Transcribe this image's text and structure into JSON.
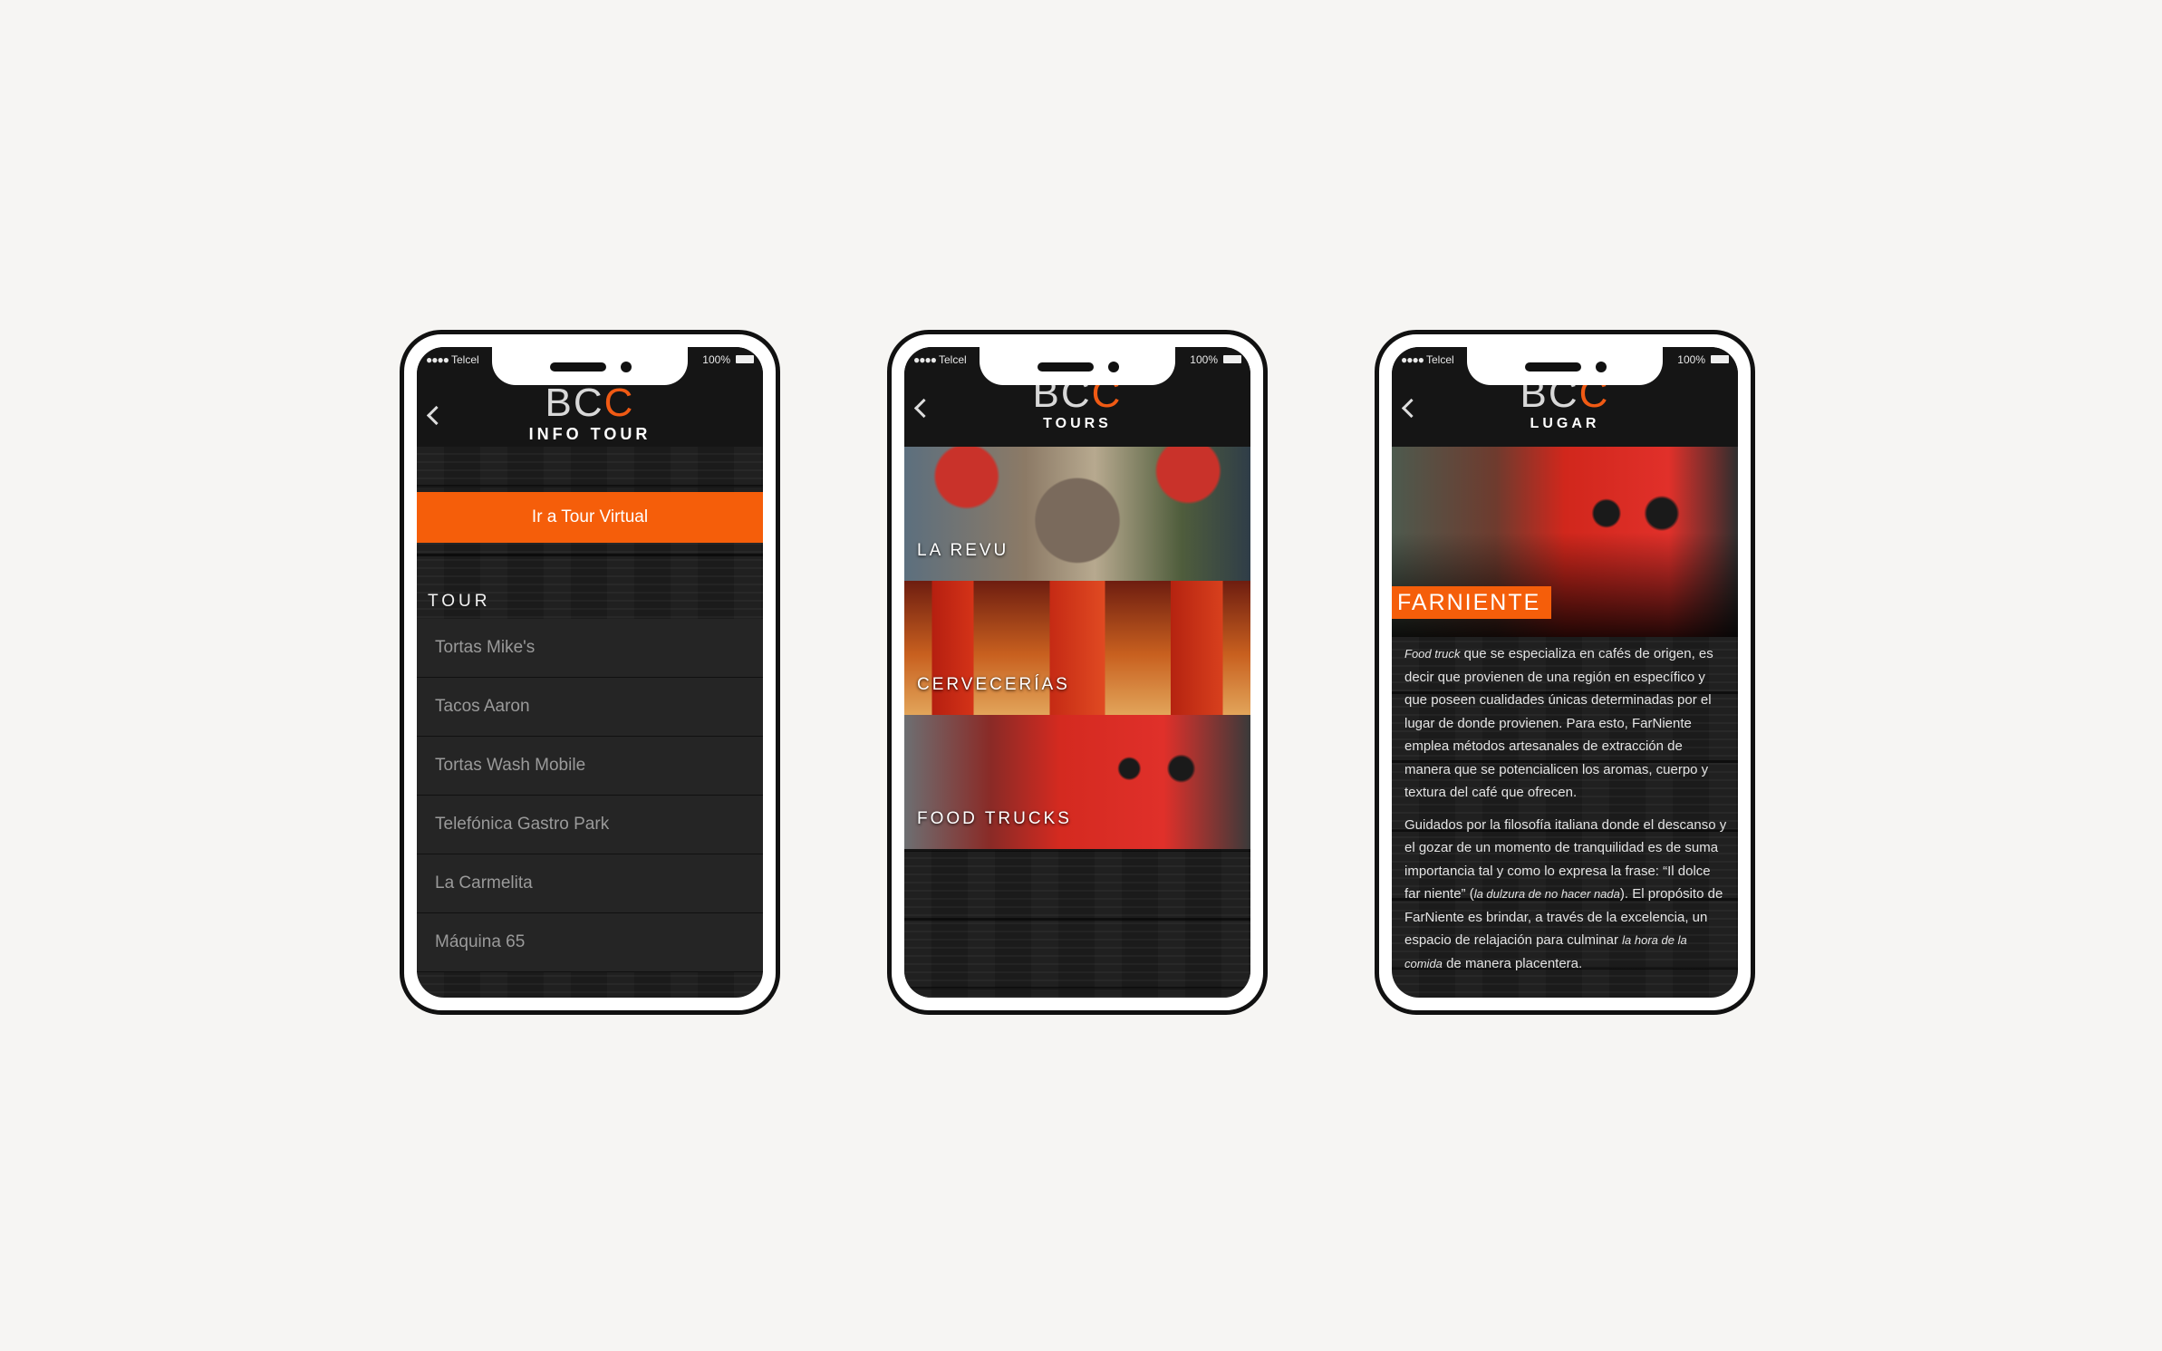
{
  "status_bar": {
    "signal": "●●●●",
    "carrier": "Telcel",
    "battery": "100%"
  },
  "app": {
    "logo_main": "BC",
    "logo_accent": "C",
    "accent_color": "#f55e0a"
  },
  "screen_info_tour": {
    "title": "INFO TOUR",
    "virtual_tour_button": "Ir a Tour Virtual",
    "section_label": "TOUR",
    "items": [
      "Tortas Mike's",
      "Tacos Aaron",
      "Tortas Wash Mobile",
      "Telefónica Gastro Park",
      "La Carmelita",
      "Máquina 65"
    ]
  },
  "screen_tours": {
    "title": "TOURS",
    "tiles": [
      "LA REVU",
      "CERVECERÍAS",
      "FOOD TRUCKS"
    ]
  },
  "screen_lugar": {
    "title": "LUGAR",
    "place_name": "FARNIENTE",
    "p1_em": "Food truck",
    "p1": " que se especializa en cafés de origen, es decir que provienen de una región en específico y que poseen cualidades únicas determinadas por el lugar de donde provienen. Para esto, FarNiente emplea métodos artesanales de extracción de manera que se potencialicen los aromas, cuerpo y textura del café que ofrecen.",
    "p2_a": "Guidados por la filosofía italiana donde el descanso y el gozar de un momento de tranquilidad es de suma importancia tal y como lo expresa la frase: “Il dolce far niente” (",
    "p2_em1": "la dulzura de no hacer nada",
    "p2_b": "). El propósito de FarNiente es brindar, a través de la excelencia, un espacio de relajación para culminar ",
    "p2_em2": "la hora de la comida",
    "p2_c": " de manera placentera."
  }
}
